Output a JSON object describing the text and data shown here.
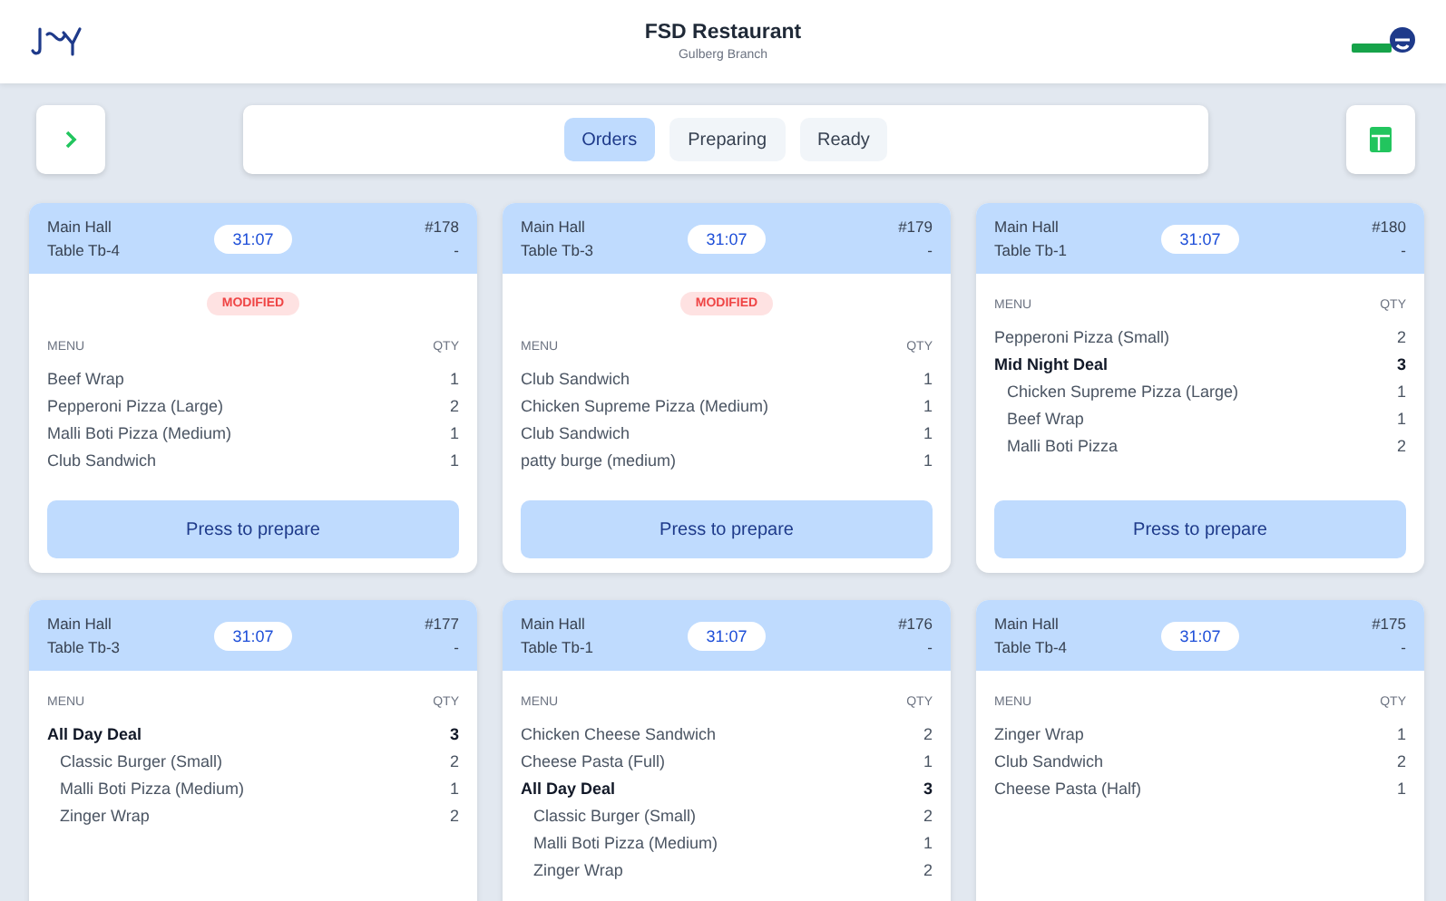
{
  "header": {
    "title": "FSD Restaurant",
    "subtitle": "Gulberg Branch"
  },
  "tabs": [
    {
      "label": "Orders",
      "selected": true
    },
    {
      "label": "Preparing",
      "selected": false
    },
    {
      "label": "Ready",
      "selected": false
    }
  ],
  "orders": [
    {
      "hall": "Main Hall",
      "table": "Table Tb-4",
      "timer": "31:07",
      "number": "#178",
      "note": "-",
      "modified": true,
      "badge": "MODIFIED",
      "menu_label": "MENU",
      "qty_label": "QTY",
      "action": "Press to prepare",
      "items": [
        {
          "kind": "item",
          "name": "Beef Wrap",
          "qty": "1"
        },
        {
          "kind": "item",
          "name": "Pepperoni Pizza (Large)",
          "qty": "2"
        },
        {
          "kind": "item",
          "name": "Malli Boti Pizza (Medium)",
          "qty": "1"
        },
        {
          "kind": "item",
          "name": "Club Sandwich",
          "qty": "1"
        }
      ]
    },
    {
      "hall": "Main Hall",
      "table": "Table Tb-3",
      "timer": "31:07",
      "number": "#179",
      "note": "-",
      "modified": true,
      "badge": "MODIFIED",
      "menu_label": "MENU",
      "qty_label": "QTY",
      "action": "Press to prepare",
      "items": [
        {
          "kind": "item",
          "name": "Club Sandwich",
          "qty": "1"
        },
        {
          "kind": "item",
          "name": "Chicken Supreme Pizza (Medium)",
          "qty": "1"
        },
        {
          "kind": "item",
          "name": "Club Sandwich",
          "qty": "1"
        },
        {
          "kind": "item",
          "name": "patty burge (medium)",
          "qty": "1"
        }
      ]
    },
    {
      "hall": "Main Hall",
      "table": "Table Tb-1",
      "timer": "31:07",
      "number": "#180",
      "note": "-",
      "modified": false,
      "menu_label": "MENU",
      "qty_label": "QTY",
      "action": "Press to prepare",
      "items": [
        {
          "kind": "item",
          "name": "Pepperoni Pizza (Small)",
          "qty": "2"
        },
        {
          "kind": "deal",
          "name": "Mid Night Deal",
          "qty": "3",
          "children": [
            {
              "name": "Chicken Supreme Pizza (Large)",
              "qty": "1"
            },
            {
              "name": "Beef Wrap",
              "qty": "1"
            },
            {
              "name": "Malli Boti Pizza",
              "qty": "2"
            }
          ]
        }
      ]
    },
    {
      "hall": "Main Hall",
      "table": "Table Tb-3",
      "timer": "31:07",
      "number": "#177",
      "note": "-",
      "modified": false,
      "menu_label": "MENU",
      "qty_label": "QTY",
      "items": [
        {
          "kind": "deal",
          "name": "All Day Deal",
          "qty": "3",
          "children": [
            {
              "name": "Classic Burger (Small)",
              "qty": "2"
            },
            {
              "name": "Malli Boti Pizza (Medium)",
              "qty": "1"
            },
            {
              "name": "Zinger Wrap",
              "qty": "2"
            }
          ]
        }
      ]
    },
    {
      "hall": "Main Hall",
      "table": "Table Tb-1",
      "timer": "31:07",
      "number": "#176",
      "note": "-",
      "modified": false,
      "menu_label": "MENU",
      "qty_label": "QTY",
      "items": [
        {
          "kind": "item",
          "name": "Chicken Cheese Sandwich",
          "qty": "2"
        },
        {
          "kind": "item",
          "name": "Cheese Pasta (Full)",
          "qty": "1"
        },
        {
          "kind": "deal",
          "name": "All Day Deal",
          "qty": "3",
          "children": [
            {
              "name": "Classic Burger (Small)",
              "qty": "2"
            },
            {
              "name": "Malli Boti Pizza (Medium)",
              "qty": "1"
            },
            {
              "name": "Zinger Wrap",
              "qty": "2"
            }
          ]
        }
      ]
    },
    {
      "hall": "Main Hall",
      "table": "Table Tb-4",
      "timer": "31:07",
      "number": "#175",
      "note": "-",
      "modified": false,
      "menu_label": "MENU",
      "qty_label": "QTY",
      "items": [
        {
          "kind": "item",
          "name": "Zinger Wrap",
          "qty": "1"
        },
        {
          "kind": "item",
          "name": "Club Sandwich",
          "qty": "2"
        },
        {
          "kind": "item",
          "name": "Cheese Pasta (Half)",
          "qty": "1"
        }
      ]
    }
  ]
}
